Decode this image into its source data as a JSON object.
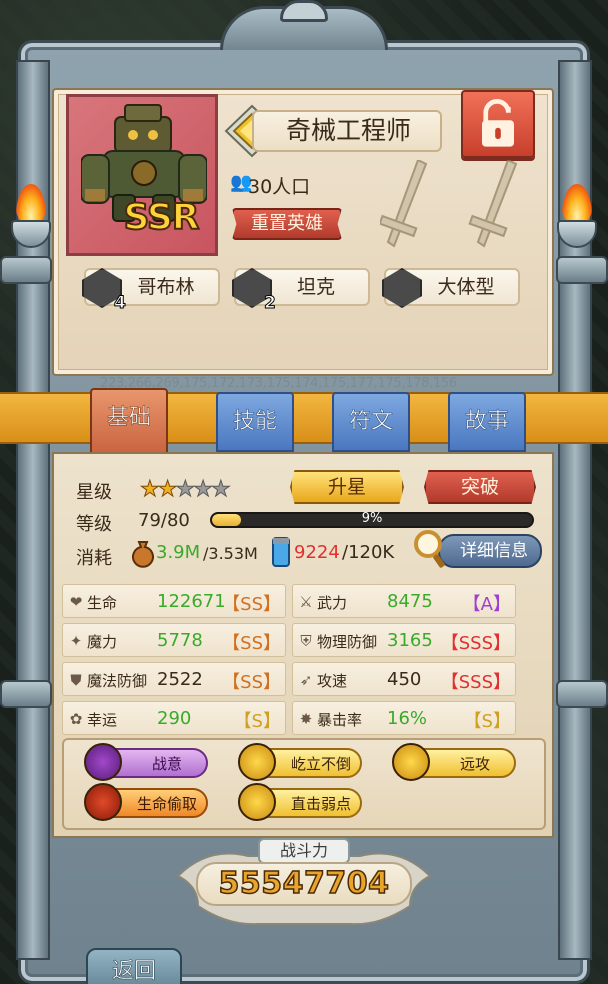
{
  "hero": {
    "name": "奇械工程师",
    "rarity": "SSR",
    "population": "30人口",
    "reset_label": "重置英雄"
  },
  "tags": [
    {
      "num": "4",
      "label": "哥布林",
      "icon": "goblin-icon"
    },
    {
      "num": "2",
      "label": "坦克",
      "icon": "shield-icon"
    },
    {
      "num": "",
      "label": "大体型",
      "icon": "large-body-icon"
    }
  ],
  "faded_line": "223,266,269,175,172,173,175,174,175,177,175,178,156",
  "tabs": [
    {
      "label": "基础",
      "active": true
    },
    {
      "label": "技能",
      "active": false
    },
    {
      "label": "符文",
      "active": false
    },
    {
      "label": "故事",
      "active": false
    }
  ],
  "progress": {
    "star_label": "星级",
    "stars_filled": 2,
    "stars_total": 5,
    "upgrade_star_label": "升星",
    "breakthrough_label": "突破",
    "level_label": "等级",
    "level_value": "79/80",
    "xp_percent_text": "9%",
    "xp_fraction": 0.09,
    "cost_label": "消耗",
    "gold_current": "3.9M",
    "gold_required": "/3.53M",
    "potion_current": "9224",
    "potion_required": "/120K",
    "detail_label": "详细信息"
  },
  "stats": [
    {
      "name": "生命",
      "value": "122671",
      "grade": "【SS】",
      "icon": "heart-icon",
      "value_color": "#3aaa2a",
      "grade_color": "#d07020"
    },
    {
      "name": "武力",
      "value": "8475",
      "grade": "【A】",
      "icon": "sword-icon",
      "value_color": "#3aaa2a",
      "grade_color": "#a040d0"
    },
    {
      "name": "魔力",
      "value": "5778",
      "grade": "【SS】",
      "icon": "sparkle-icon",
      "value_color": "#3aaa2a",
      "grade_color": "#d07020"
    },
    {
      "name": "物理防御",
      "value": "3165",
      "grade": "【SSS】",
      "icon": "shield-icon",
      "value_color": "#3aaa2a",
      "grade_color": "#e03030"
    },
    {
      "name": "魔法防御",
      "value": "2522",
      "grade": "【SS】",
      "icon": "magic-shield-icon",
      "value_color": "#3b2a1a",
      "grade_color": "#d07020"
    },
    {
      "name": "攻速",
      "value": "450",
      "grade": "【SSS】",
      "icon": "speed-icon",
      "value_color": "#3b2a1a",
      "grade_color": "#e03030"
    },
    {
      "name": "幸运",
      "value": "290",
      "grade": "【S】",
      "icon": "luck-icon",
      "value_color": "#3aaa2a",
      "grade_color": "#d0a020"
    },
    {
      "name": "暴击率",
      "value": "16%",
      "grade": "【S】",
      "icon": "crit-icon",
      "value_color": "#3aaa2a",
      "grade_color": "#d0a020"
    }
  ],
  "skills": [
    {
      "label": "战意",
      "style": "purple"
    },
    {
      "label": "屹立不倒",
      "style": "gold"
    },
    {
      "label": "远攻",
      "style": "gold"
    },
    {
      "label": "生命偷取",
      "style": "orange"
    },
    {
      "label": "直击弱点",
      "style": "gold"
    }
  ],
  "power": {
    "label": "战斗力",
    "value": "55547704"
  },
  "back_label": "返回",
  "colors": {
    "ribbon": "#e8a42a",
    "tab_active": "#d8794f",
    "tab_inactive": "#5a88d0",
    "gold_value": "#3aaa2a",
    "potion_value": "#e03030"
  }
}
